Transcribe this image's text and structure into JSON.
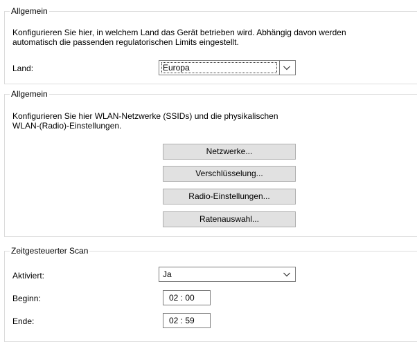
{
  "country_group": {
    "title": "Allgemein",
    "description_line1": "Konfigurieren Sie hier, in welchem Land das Gerät betrieben wird. Abhängig davon werden",
    "description_line2": "automatisch die passenden regulatorischen Limits eingestellt.",
    "land_label": "Land:",
    "land_value": "Europa"
  },
  "wlan_group": {
    "title": "Allgemein",
    "description_line1": "Konfigurieren Sie hier WLAN-Netzwerke (SSIDs) und die physikalischen",
    "description_line2": "WLAN-(Radio)-Einstellungen.",
    "buttons": {
      "networks": "Netzwerke...",
      "encryption": "Verschlüsselung...",
      "radio": "Radio-Einstellungen...",
      "rate": "Ratenauswahl..."
    }
  },
  "scan_group": {
    "title": "Zeitgesteuerter Scan",
    "activated_label": "Aktiviert:",
    "activated_value": "Ja",
    "begin_label": "Beginn:",
    "begin_time": "02 : 00",
    "end_label": "Ende:",
    "end_time": "02 : 59"
  },
  "icons": {
    "dropdown": "chevron-down-icon"
  },
  "colors": {
    "group_border": "#dcdcdc",
    "button_face": "#e1e1e1",
    "field_border": "#7a7a7a"
  }
}
